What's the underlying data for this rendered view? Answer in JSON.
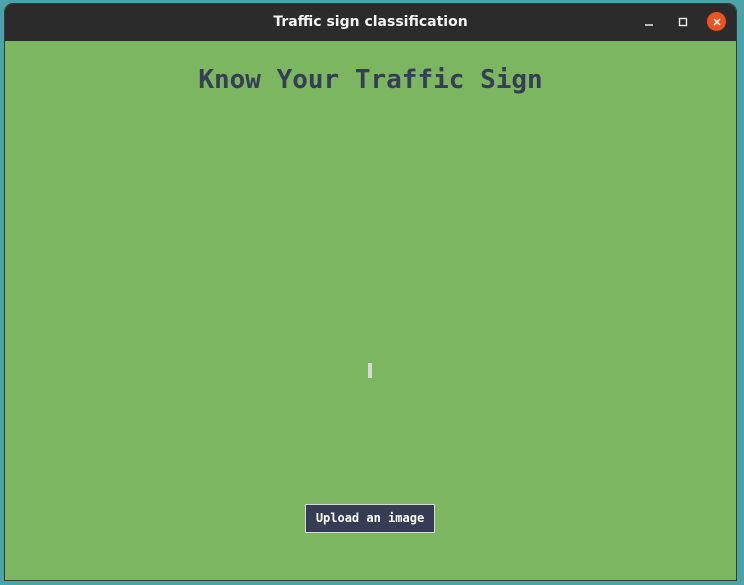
{
  "window": {
    "title": "Traffic sign classification",
    "controls": {
      "minimize_icon": "minimize-icon",
      "maximize_icon": "maximize-icon",
      "close_icon": "close-icon"
    }
  },
  "main": {
    "heading": "Know Your Traffic Sign",
    "upload_button_label": "Upload an image",
    "result_text": ""
  },
  "colors": {
    "background": "#7cb660",
    "heading": "#363d57",
    "button_bg": "#353d55",
    "button_text": "#ffffff",
    "titlebar": "#2b2b2b",
    "close_button": "#e95420"
  }
}
